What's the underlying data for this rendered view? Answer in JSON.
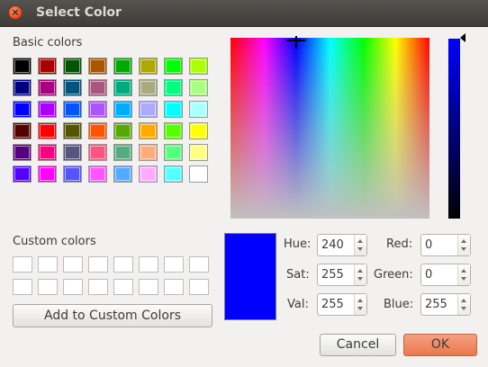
{
  "window": {
    "title": "Select Color",
    "close_symbol": "×"
  },
  "basic": {
    "label": "Basic colors",
    "colors": [
      "#000000",
      "#aa0000",
      "#005500",
      "#aa5500",
      "#00aa00",
      "#aaaa00",
      "#00ff00",
      "#aaff00",
      "#00007f",
      "#aa007f",
      "#00557f",
      "#aa557f",
      "#00aa7f",
      "#aaaa7f",
      "#00ff7f",
      "#aaff7f",
      "#0000ff",
      "#aa00ff",
      "#0055ff",
      "#aa55ff",
      "#00aaff",
      "#aaaaff",
      "#00ffff",
      "#aaffff",
      "#550000",
      "#ff0000",
      "#555500",
      "#ff5500",
      "#55aa00",
      "#ffaa00",
      "#55ff00",
      "#ffff00",
      "#55007f",
      "#ff007f",
      "#55557f",
      "#ff557f",
      "#55aa7f",
      "#ffaa7f",
      "#55ff7f",
      "#ffff7f",
      "#5500ff",
      "#ff00ff",
      "#5555ff",
      "#ff55ff",
      "#55aaff",
      "#ffaaff",
      "#55ffff",
      "#ffffff"
    ]
  },
  "custom": {
    "label": "Custom colors",
    "colors": [
      "#ffffff",
      "#ffffff",
      "#ffffff",
      "#ffffff",
      "#ffffff",
      "#ffffff",
      "#ffffff",
      "#ffffff",
      "#ffffff",
      "#ffffff",
      "#ffffff",
      "#ffffff",
      "#ffffff",
      "#ffffff",
      "#ffffff",
      "#ffffff"
    ],
    "add_button": "Add to Custom Colors"
  },
  "current_color": "#0000ff",
  "fields": {
    "hue": {
      "label": "Hue:",
      "value": "240"
    },
    "sat": {
      "label": "Sat:",
      "value": "255"
    },
    "val": {
      "label": "Val:",
      "value": "255"
    },
    "red": {
      "label": "Red:",
      "value": "0"
    },
    "green": {
      "label": "Green:",
      "value": "0"
    },
    "blue": {
      "label": "Blue:",
      "value": "255"
    }
  },
  "buttons": {
    "cancel": "Cancel",
    "ok": "OK"
  }
}
